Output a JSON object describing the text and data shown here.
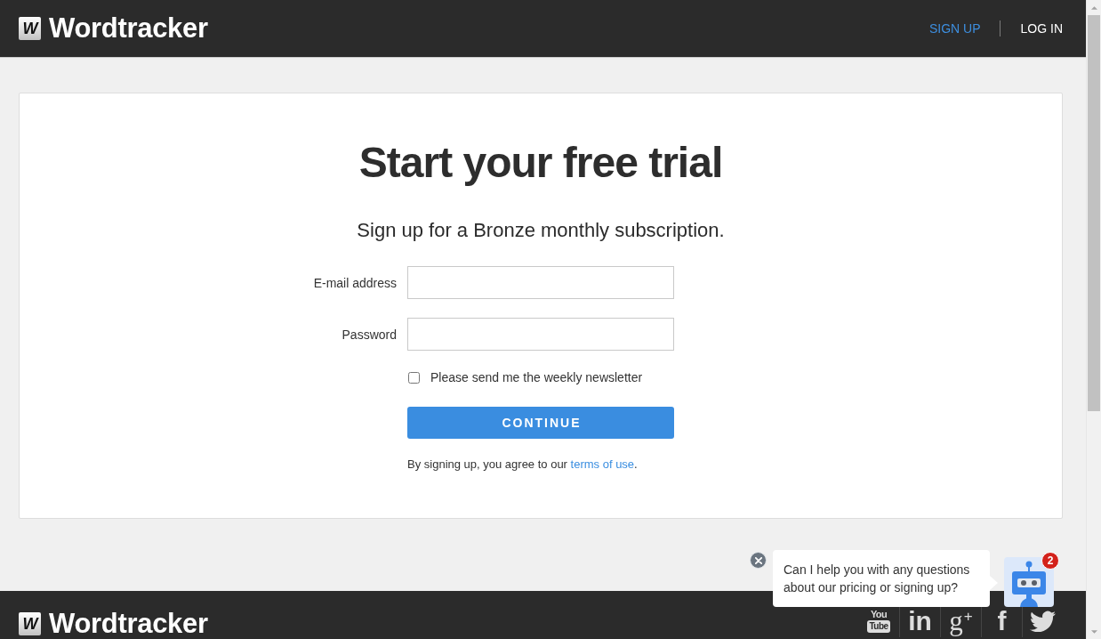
{
  "header": {
    "logo": {
      "mark": "W",
      "name": "Wordtracker"
    },
    "nav": [
      {
        "label": "SIGN UP",
        "selected": true
      },
      {
        "label": "LOG IN",
        "selected": false
      }
    ]
  },
  "signup_card": {
    "title": "Start your free trial",
    "subtitle": "Sign up for a Bronze monthly subscription.",
    "fields": [
      {
        "label": "E-mail address"
      },
      {
        "label": "Password"
      }
    ],
    "newsletter": {
      "label": "Please send me the weekly newsletter",
      "checked": false
    },
    "submit_button": "CONTINUE",
    "terms": {
      "text": "By signing up, you agree to our ",
      "link": "terms of use",
      "end": "."
    }
  },
  "chat_widget": {
    "message": "Can I help you with any questions about our pricing or signing up?",
    "badge": "2"
  },
  "footer": {
    "logo": {
      "mark": "W",
      "name": "Wordtracker"
    },
    "social_links": [
      {
        "kind": "stacked",
        "top": "You",
        "bottom": "Tube"
      },
      {
        "kind": "bold",
        "text": "in"
      },
      {
        "kind": "serif",
        "text": "g$^{+}$"
      },
      {
        "kind": "bold",
        "text": "f"
      },
      {
        "kind": "bird"
      }
    ]
  }
}
